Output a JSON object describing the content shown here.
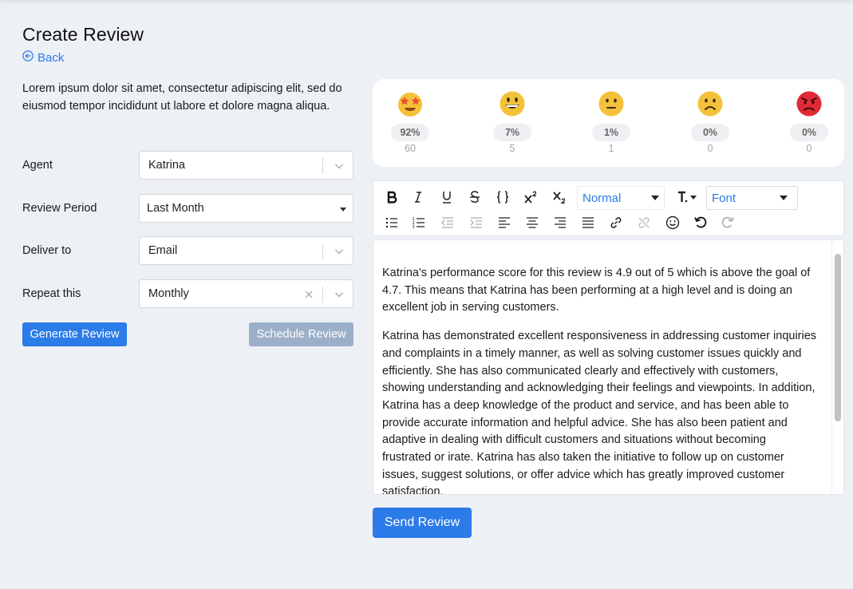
{
  "page": {
    "title": "Create Review",
    "back_label": "Back",
    "intro": "Lorem ipsum dolor sit amet, consectetur adipiscing elit, sed do eiusmod tempor incididunt ut labore et dolore magna aliqua."
  },
  "form": {
    "agent": {
      "label": "Agent",
      "value": "Katrina"
    },
    "review_period": {
      "label": "Review Period",
      "value": "Last Month"
    },
    "deliver_to": {
      "label": "Deliver to",
      "value": "Email"
    },
    "repeat": {
      "label": "Repeat this",
      "value": "Monthly"
    },
    "generate_label": "Generate Review",
    "schedule_label": "Schedule Review"
  },
  "ratings": [
    {
      "icon": "star-struck-emoji-icon",
      "percent": "92%",
      "count": "60"
    },
    {
      "icon": "grinning-emoji-icon",
      "percent": "7%",
      "count": "5"
    },
    {
      "icon": "neutral-emoji-icon",
      "percent": "1%",
      "count": "1"
    },
    {
      "icon": "frowning-emoji-icon",
      "percent": "0%",
      "count": "0"
    },
    {
      "icon": "angry-emoji-icon",
      "percent": "0%",
      "count": "0"
    }
  ],
  "toolbar": {
    "size_select": "Normal",
    "font_select": "Font",
    "colors": {
      "accent": "#2b7be8"
    }
  },
  "editor": {
    "paragraphs": [
      "Katrina's performance score for this review is 4.9 out of 5 which is above the goal of 4.7. This means that Katrina has been performing at a high level and is doing an excellent job in serving customers.",
      "Katrina has demonstrated excellent responsiveness in addressing customer inquiries and complaints in a timely manner, as well as solving customer issues quickly and efficiently. She has also communicated clearly and effectively with customers, showing understanding and acknowledging their feelings and viewpoints. In addition, Katrina has a deep knowledge of the product and service, and has been able to provide accurate information and helpful advice. She has also been patient and adaptive in dealing with difficult customers and situations without becoming frustrated or irate. Katrina has also taken the initiative to follow up on customer issues, suggest solutions, or offer advice which has greatly improved customer satisfaction."
    ]
  },
  "send_label": "Send Review",
  "colors": {
    "primary": "#2b7be8",
    "disabled": "#9cafc8",
    "background": "#edf0f5"
  }
}
